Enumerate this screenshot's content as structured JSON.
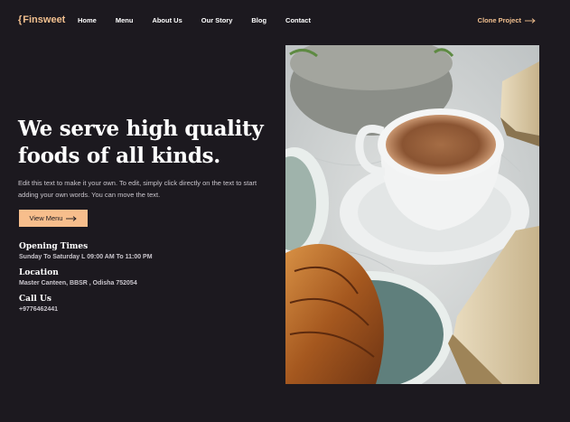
{
  "nav": {
    "logo": "Finsweet",
    "logo_brace": "{",
    "links": [
      "Home",
      "Menu",
      "About Us",
      "Our Story",
      "Blog",
      "Contact"
    ],
    "cta": "Clone Project"
  },
  "hero": {
    "title": "We serve high quality foods of all kinds.",
    "description": "Edit this text to make it your own. To edit, simply click directly on the text to start adding your own words. You can move the text.",
    "button": "View Menu"
  },
  "info": {
    "opening": {
      "title": "Opening Times",
      "value": "Sunday To Saturday  L  09:00 AM To 11:00 PM"
    },
    "location": {
      "title": "Location",
      "value": "Master Canteen, BBSR , Odisha 752054"
    },
    "call": {
      "title": "Call Us",
      "value": "+9776462441"
    }
  },
  "colors": {
    "background": "#1c191f",
    "accent": "#f7be8c",
    "text": "#ffffff",
    "muted": "#c9c5cc"
  },
  "icons": {
    "clone_arrow": "arrow-right-icon",
    "button_arrow": "arrow-right-icon"
  }
}
